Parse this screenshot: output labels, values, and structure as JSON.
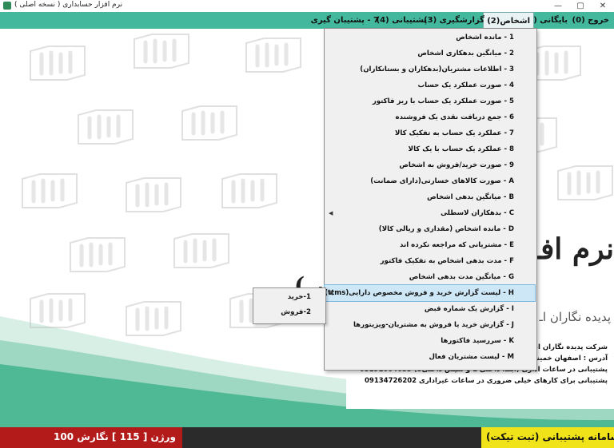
{
  "window": {
    "title": "نرم افزار حسابداری ( نسخه اصلی )",
    "minimize_glyph": "—",
    "maximize_glyph": "▢",
    "close_glyph": "✕"
  },
  "menubar": {
    "items": [
      {
        "label": "خروج (0)"
      },
      {
        "label": "بایگانی (1)"
      },
      {
        "label": "اشخاص(2)"
      },
      {
        "label": "گزارشگیری (3)"
      },
      {
        "label": "پشتیبانی (4)"
      },
      {
        "label": "7 - پشتیبان گیری"
      }
    ]
  },
  "dropdown": {
    "items": [
      {
        "label": "1 - مانده اشخاص"
      },
      {
        "label": "2 - میانگین بدهکاری اشخاص"
      },
      {
        "label": "3 - اطلاعات مشتریان(بدهکاران و بستانکاران)"
      },
      {
        "label": "4 - صورت عملکرد یک حساب"
      },
      {
        "label": "5 - صورت عملکرد یک حساب با ریز فاکتور"
      },
      {
        "label": "6 - جمع دریافت نقدی یک فروشنده"
      },
      {
        "label": "7 - عملکرد یک حساب به تفکیک کالا"
      },
      {
        "label": "8 - عملکرد یک حساب با یک کالا"
      },
      {
        "label": "9 - صورت خرید/فروش به اشخاص"
      },
      {
        "label": "A - صورت کالاهای خسارتی(دارای ضمانت)"
      },
      {
        "label": "B - میانگین بدهی اشخاص"
      },
      {
        "label": "C - بدهکاران لاسطلی"
      },
      {
        "label": "D - مانده اشخاص (مقداری و ریالی کالا)"
      },
      {
        "label": "E - مشتریانی که مراجعه نکرده اند"
      },
      {
        "label": "F - مدت بدهی اشخاص به تفکیک فاکتور"
      },
      {
        "label": "G - میانگین مدت بدهی اشخاص"
      },
      {
        "label": "H - لیست گزارش خرید و فروش مخصوص دارایی(ttms)"
      },
      {
        "label": "I - گزارش یک شماره قبض"
      },
      {
        "label": "J - گزارش خرید یا فروش به مشتریان-ویزیتورها"
      },
      {
        "label": "K - سررسید فاکتورها"
      },
      {
        "label": "M - لیست مشتریان فعال"
      }
    ],
    "submenu_arrow": "◀"
  },
  "submenu": {
    "items": [
      {
        "label": "1-خرید"
      },
      {
        "label": "2-فروش"
      }
    ]
  },
  "background": {
    "title": "نرم افـ",
    "title2": "( زار",
    "subtitle": "پدیده نگاران اـ",
    "watermark_text": "پدیده"
  },
  "info": {
    "company": "شرکت پدیده نگاران اندیشه",
    "address": "آدرس : اصفهان خمینی شهر خیابان شهید صدوقی ابتدای کوچه احمدی پلاک 81",
    "support_hours": "پشتیبانی در ساعات اداری (ابتدا داخلی 1 و سپس داخلی3) 03191004033",
    "emergency": "پشتیبانی برای کارهای خیلی ضروری در ساعات غیراداری 09134726202"
  },
  "statusbar": {
    "version": "ورژن [ 115 ] نگارش 100",
    "support": "سامانه پشتیبانی (ثبت تیکت)"
  },
  "colors": {
    "menubar": "#43b89c",
    "status_red": "#b31b1b",
    "status_dark": "#2b2b2b",
    "status_yellow": "#f0e31a",
    "highlight": "#cde7f7"
  }
}
